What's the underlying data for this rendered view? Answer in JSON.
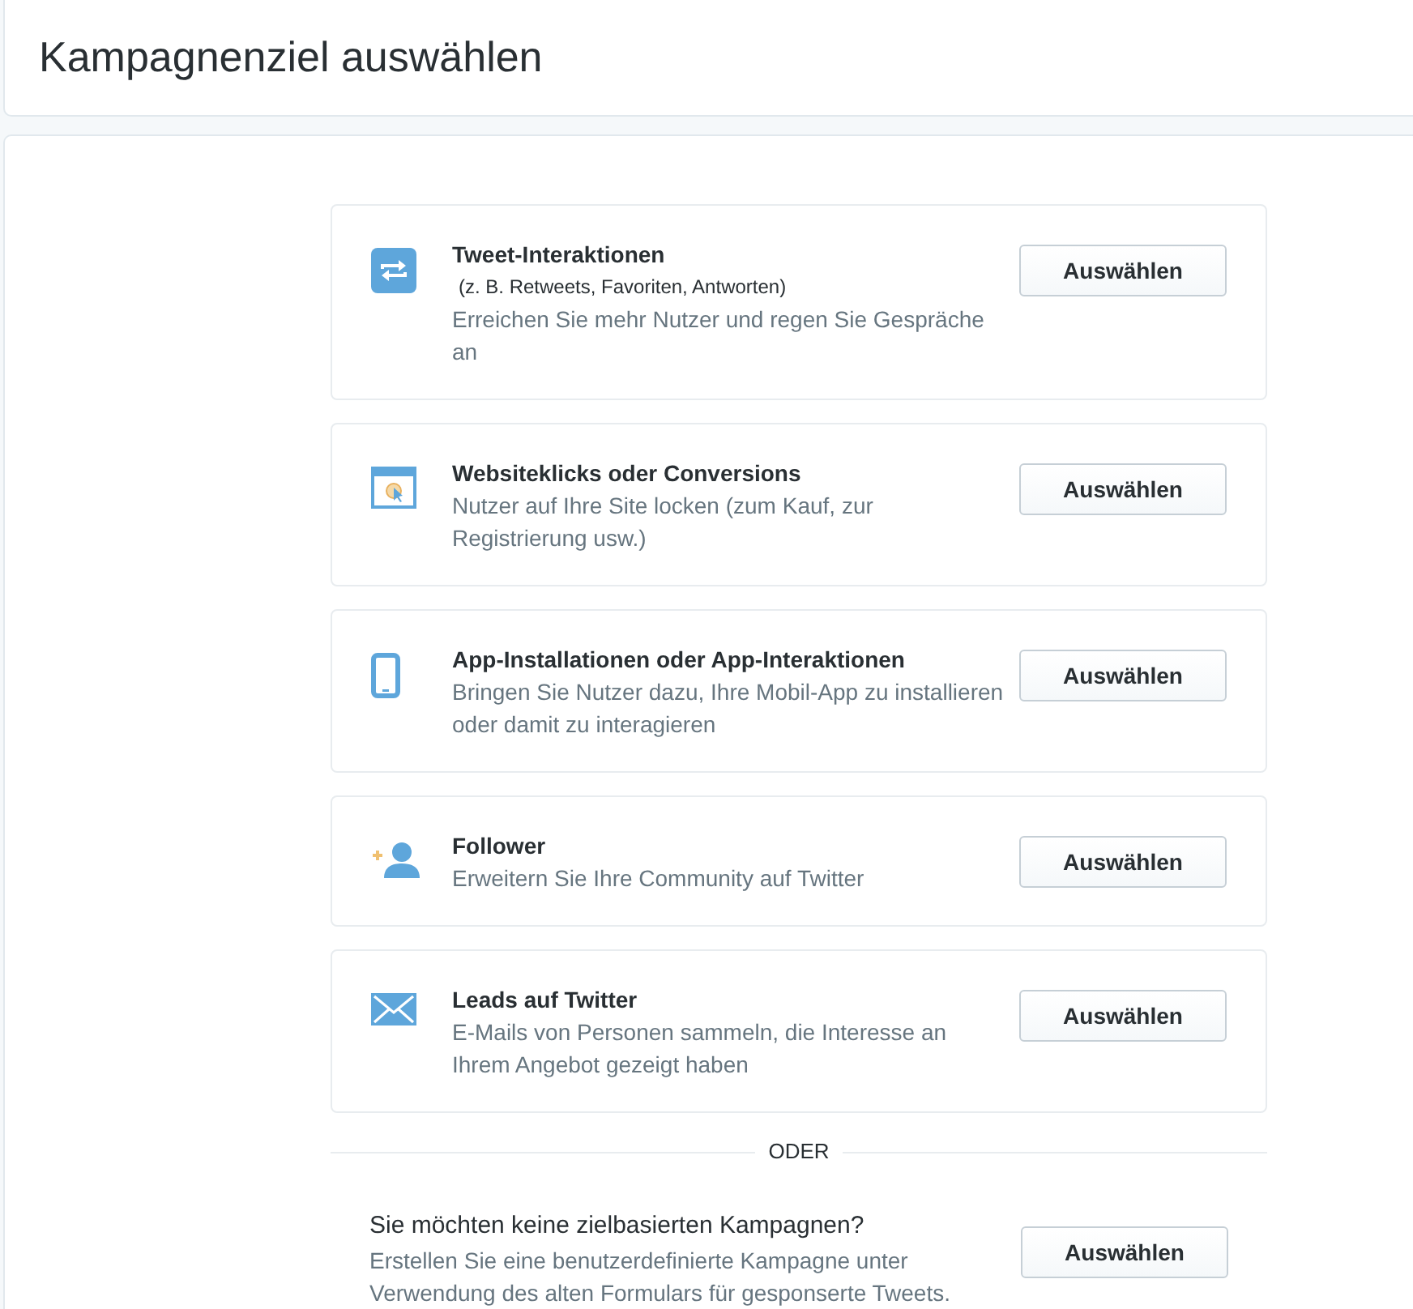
{
  "header": {
    "title": "Kampagnenziel auswählen"
  },
  "objectives": [
    {
      "kind": "engagement",
      "title": "Tweet-Interaktionen",
      "note": "(z. B. Retweets, Favoriten, Antworten)",
      "description": "Erreichen Sie mehr Nutzer und regen Sie Gespräche an",
      "button": "Auswählen"
    },
    {
      "kind": "website",
      "title": "Websiteklicks oder Conversions",
      "description": "Nutzer auf Ihre Site locken (zum Kauf, zur Registrierung usw.)",
      "button": "Auswählen"
    },
    {
      "kind": "app",
      "title": "App-Installationen oder App-Interaktionen",
      "description": "Bringen Sie Nutzer dazu, Ihre Mobil-App zu installieren oder damit zu interagieren",
      "button": "Auswählen"
    },
    {
      "kind": "followers",
      "title": "Follower",
      "description": "Erweitern Sie Ihre Community auf Twitter",
      "button": "Auswählen"
    },
    {
      "kind": "leads",
      "title": "Leads auf Twitter",
      "description": "E-Mails von Personen sammeln, die Interesse an Ihrem Angebot gezeigt haben",
      "button": "Auswählen"
    }
  ],
  "separator": "ODER",
  "custom": {
    "title": "Sie möchten keine zielbasierten Kampagnen?",
    "description": "Erstellen Sie eine benutzerdefinierte Kampagne unter Verwendung des alten Formulars für gesponserte Tweets.",
    "button": "Auswählen"
  }
}
